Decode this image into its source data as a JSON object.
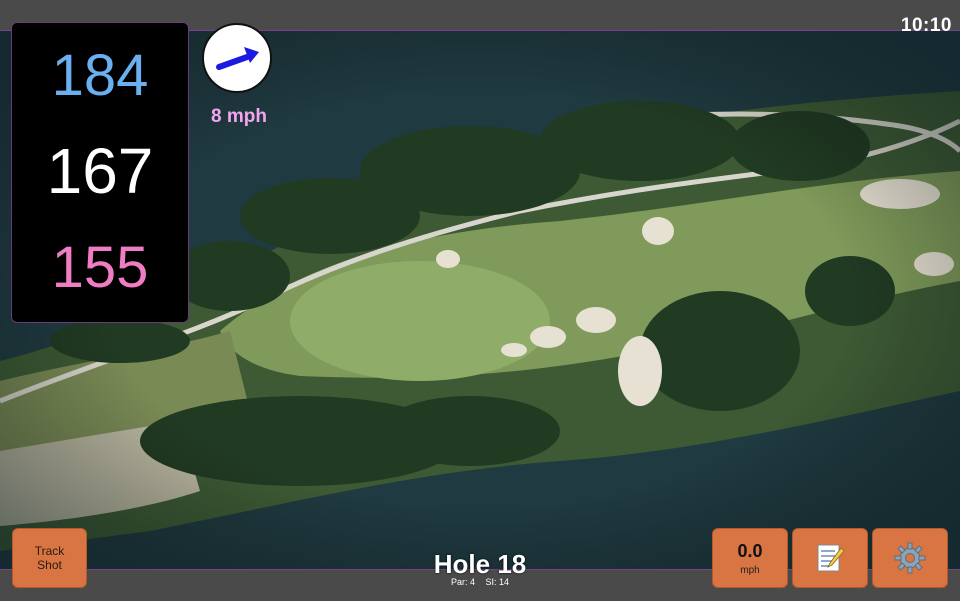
{
  "status_bar": {
    "time": "10:10"
  },
  "distances": {
    "back": "184",
    "middle": "167",
    "front": "155"
  },
  "wind": {
    "speed": "8 mph",
    "arrow_color": "#1a1ae0"
  },
  "hole": {
    "title": "Hole 18",
    "par": "Par: 4",
    "stroke_index": "SI: 14"
  },
  "buttons": {
    "track_shot_line1": "Track",
    "track_shot_line2": "Shot",
    "speed_value": "0.0",
    "speed_unit": "mph",
    "notes_icon": "memo-icon",
    "settings_icon": "gear-icon"
  },
  "colors": {
    "button": "#d97543",
    "back_distance": "#6ab0f0",
    "middle_distance": "#ffffff",
    "front_distance": "#f07cc4",
    "wind_text": "#f3a6ef",
    "border_accent": "#7a3f8f"
  }
}
